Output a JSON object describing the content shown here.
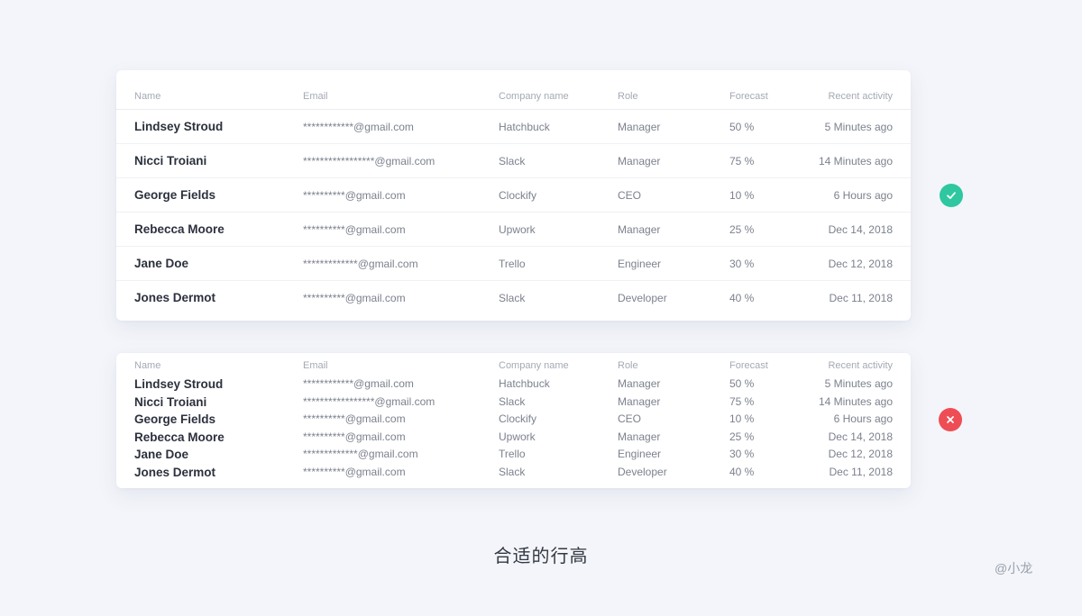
{
  "columns": {
    "name": "Name",
    "email": "Email",
    "company": "Company name",
    "role": "Role",
    "forecast": "Forecast",
    "activity": "Recent activity"
  },
  "rows": [
    {
      "name": "Lindsey Stroud",
      "email": "************@gmail.com",
      "company": "Hatchbuck",
      "role": "Manager",
      "forecast": "50 %",
      "activity": "5 Minutes ago"
    },
    {
      "name": "Nicci Troiani",
      "email": "*****************@gmail.com",
      "company": "Slack",
      "role": "Manager",
      "forecast": "75 %",
      "activity": "14 Minutes ago"
    },
    {
      "name": "George Fields",
      "email": "**********@gmail.com",
      "company": "Clockify",
      "role": "CEO",
      "forecast": "10 %",
      "activity": "6 Hours ago"
    },
    {
      "name": "Rebecca Moore",
      "email": "**********@gmail.com",
      "company": "Upwork",
      "role": "Manager",
      "forecast": "25 %",
      "activity": "Dec 14, 2018"
    },
    {
      "name": "Jane Doe",
      "email": "*************@gmail.com",
      "company": "Trello",
      "role": "Engineer",
      "forecast": "30 %",
      "activity": "Dec 12, 2018"
    },
    {
      "name": "Jones Dermot",
      "email": "**********@gmail.com",
      "company": "Slack",
      "role": "Developer",
      "forecast": "40 %",
      "activity": "Dec 11, 2018"
    }
  ],
  "icons": {
    "good": "check-icon",
    "bad": "close-icon"
  },
  "colors": {
    "good": "#2ec79f",
    "bad": "#ee4d55"
  },
  "caption": "合适的行高",
  "watermark": "@小龙"
}
